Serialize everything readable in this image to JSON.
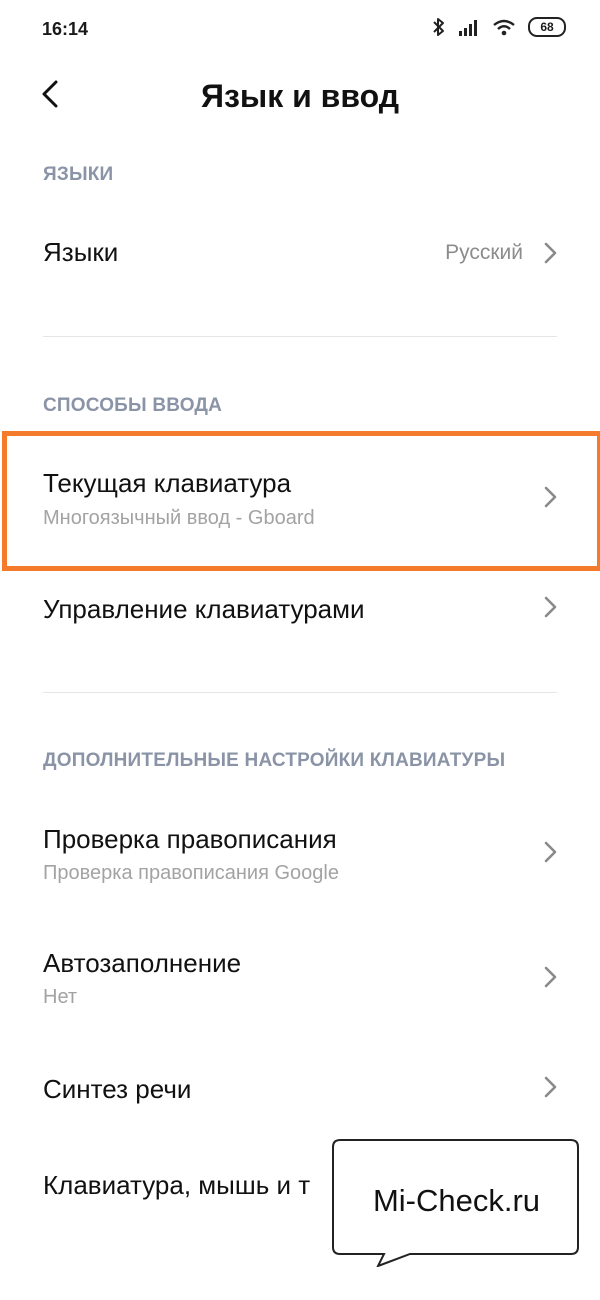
{
  "status_bar": {
    "time": "16:14",
    "battery": "68",
    "icons": [
      "bluetooth-icon",
      "signal-icon",
      "wifi-icon",
      "battery-icon"
    ]
  },
  "header": {
    "title": "Язык и ввод",
    "back_icon": "back-arrow-icon"
  },
  "sections": {
    "languages": {
      "label": "ЯЗЫКИ",
      "languages_row": {
        "title": "Языки",
        "value": "Русский"
      }
    },
    "input_methods": {
      "label": "СПОСОБЫ ВВОДА",
      "current_keyboard": {
        "title": "Текущая клавиатура",
        "subtitle": "Многоязычный ввод - Gboard"
      },
      "manage_keyboards": {
        "title": "Управление клавиатурами"
      }
    },
    "advanced": {
      "label": "ДОПОЛНИТЕЛЬНЫЕ НАСТРОЙКИ КЛАВИАТУРЫ",
      "spell_check": {
        "title": "Проверка правописания",
        "subtitle": "Проверка правописания Google"
      },
      "autofill": {
        "title": "Автозаполнение",
        "subtitle": "Нет"
      },
      "tts": {
        "title": "Синтез речи"
      },
      "keyboard_mouse": {
        "title": "Клавиатура, мышь и т"
      }
    }
  },
  "overlay": {
    "highlight_color": "#f47b2b",
    "watermark": "Mi-Check.ru"
  }
}
